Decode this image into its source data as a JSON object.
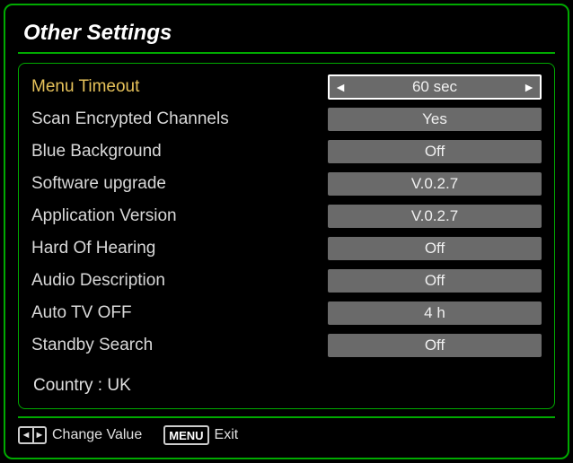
{
  "title": "Other Settings",
  "selectedIndex": 0,
  "items": [
    {
      "label": "Menu Timeout",
      "value": "60 sec"
    },
    {
      "label": "Scan Encrypted Channels",
      "value": "Yes"
    },
    {
      "label": "Blue Background",
      "value": "Off"
    },
    {
      "label": "Software upgrade",
      "value": "V.0.2.7"
    },
    {
      "label": "Application Version",
      "value": "V.0.2.7"
    },
    {
      "label": "Hard Of Hearing",
      "value": "Off"
    },
    {
      "label": "Audio Description",
      "value": "Off"
    },
    {
      "label": "Auto TV OFF",
      "value": "4 h"
    },
    {
      "label": "Standby Search",
      "value": "Off"
    }
  ],
  "country_line": "Country : UK",
  "footer": {
    "change_value": "Change Value",
    "menu_key": "MENU",
    "exit": "Exit"
  }
}
